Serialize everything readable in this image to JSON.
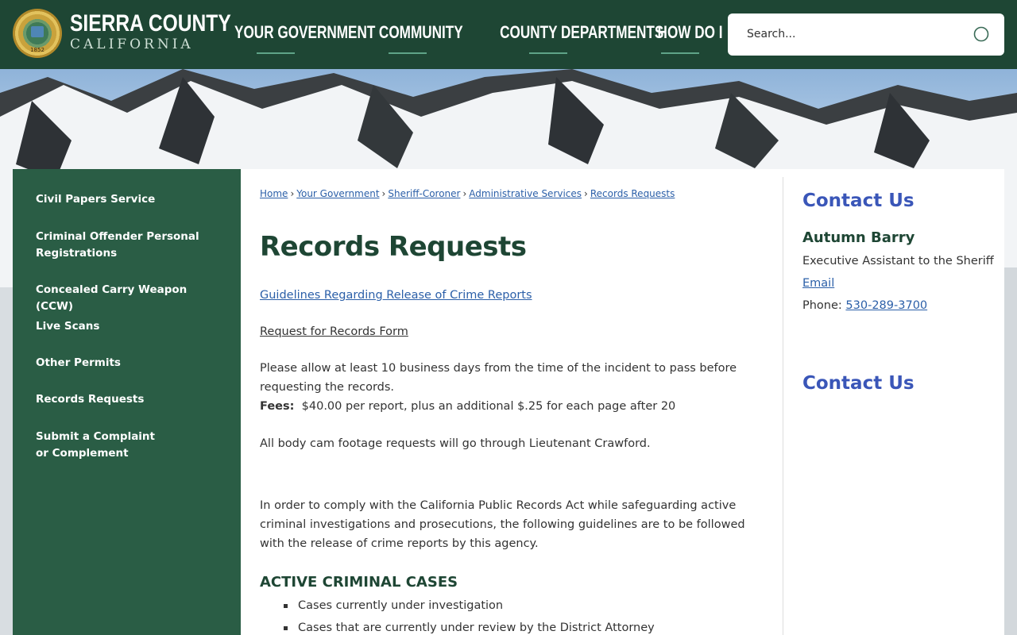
{
  "header": {
    "brand_top": "SIERRA COUNTY",
    "brand_bottom": "CALIFORNIA",
    "seal_year": "1852",
    "nav": [
      "YOUR GOVERNMENT",
      "COMMUNITY",
      "COUNTY DEPARTMENTS",
      "HOW DO I"
    ],
    "search_placeholder": "Search..."
  },
  "sidebar": {
    "items": [
      "Civil Papers Service",
      "Criminal Offender Personal Registrations",
      "Concealed Carry Weapon (CCW)",
      "Live Scans",
      "Other Permits",
      "Records Requests",
      "Submit a Complaint or Complement"
    ]
  },
  "breadcrumb": [
    "Home",
    "Your Government",
    "Sheriff-Coroner",
    "Administrative Services",
    "Records Requests"
  ],
  "main": {
    "title": "Records Requests",
    "guidelines_link": "Guidelines Regarding Release of Crime Reports",
    "form_link": "Request for Records Form",
    "allow_text": "Please allow at least 10 business days from the time of the incident to pass before requesting the records.",
    "fees_label": "Fees:",
    "fees_text": "$40.00 per report, plus an additional $.25 for each page after 20",
    "bodycam_text": "All body cam footage requests will go through Lieutenant Crawford.",
    "comply_text": "In order to comply with the California Public Records Act while safeguarding active criminal investigations and prosecutions, the following guidelines are to be followed with the release of crime reports by this agency.",
    "section_heading": "ACTIVE CRIMINAL CASES",
    "bullets": [
      "Cases currently under investigation",
      "Cases that are currently under review by the District Attorney"
    ]
  },
  "contact": {
    "title": "Contact Us",
    "name": "Autumn Barry",
    "role": "Executive Assistant to the Sheriff",
    "email_label": "Email",
    "phone_label": "Phone:",
    "phone": "530-289-3700",
    "title2": "Contact Us"
  },
  "colors": {
    "header_bg": "#1e4634",
    "sidebar_bg": "#2a5d45",
    "title_green": "#1e4634",
    "link_blue": "#2b5fa8",
    "contact_blue": "#3a56b8"
  },
  "icons": {
    "search": "search-icon",
    "seal": "county-seal-icon"
  }
}
